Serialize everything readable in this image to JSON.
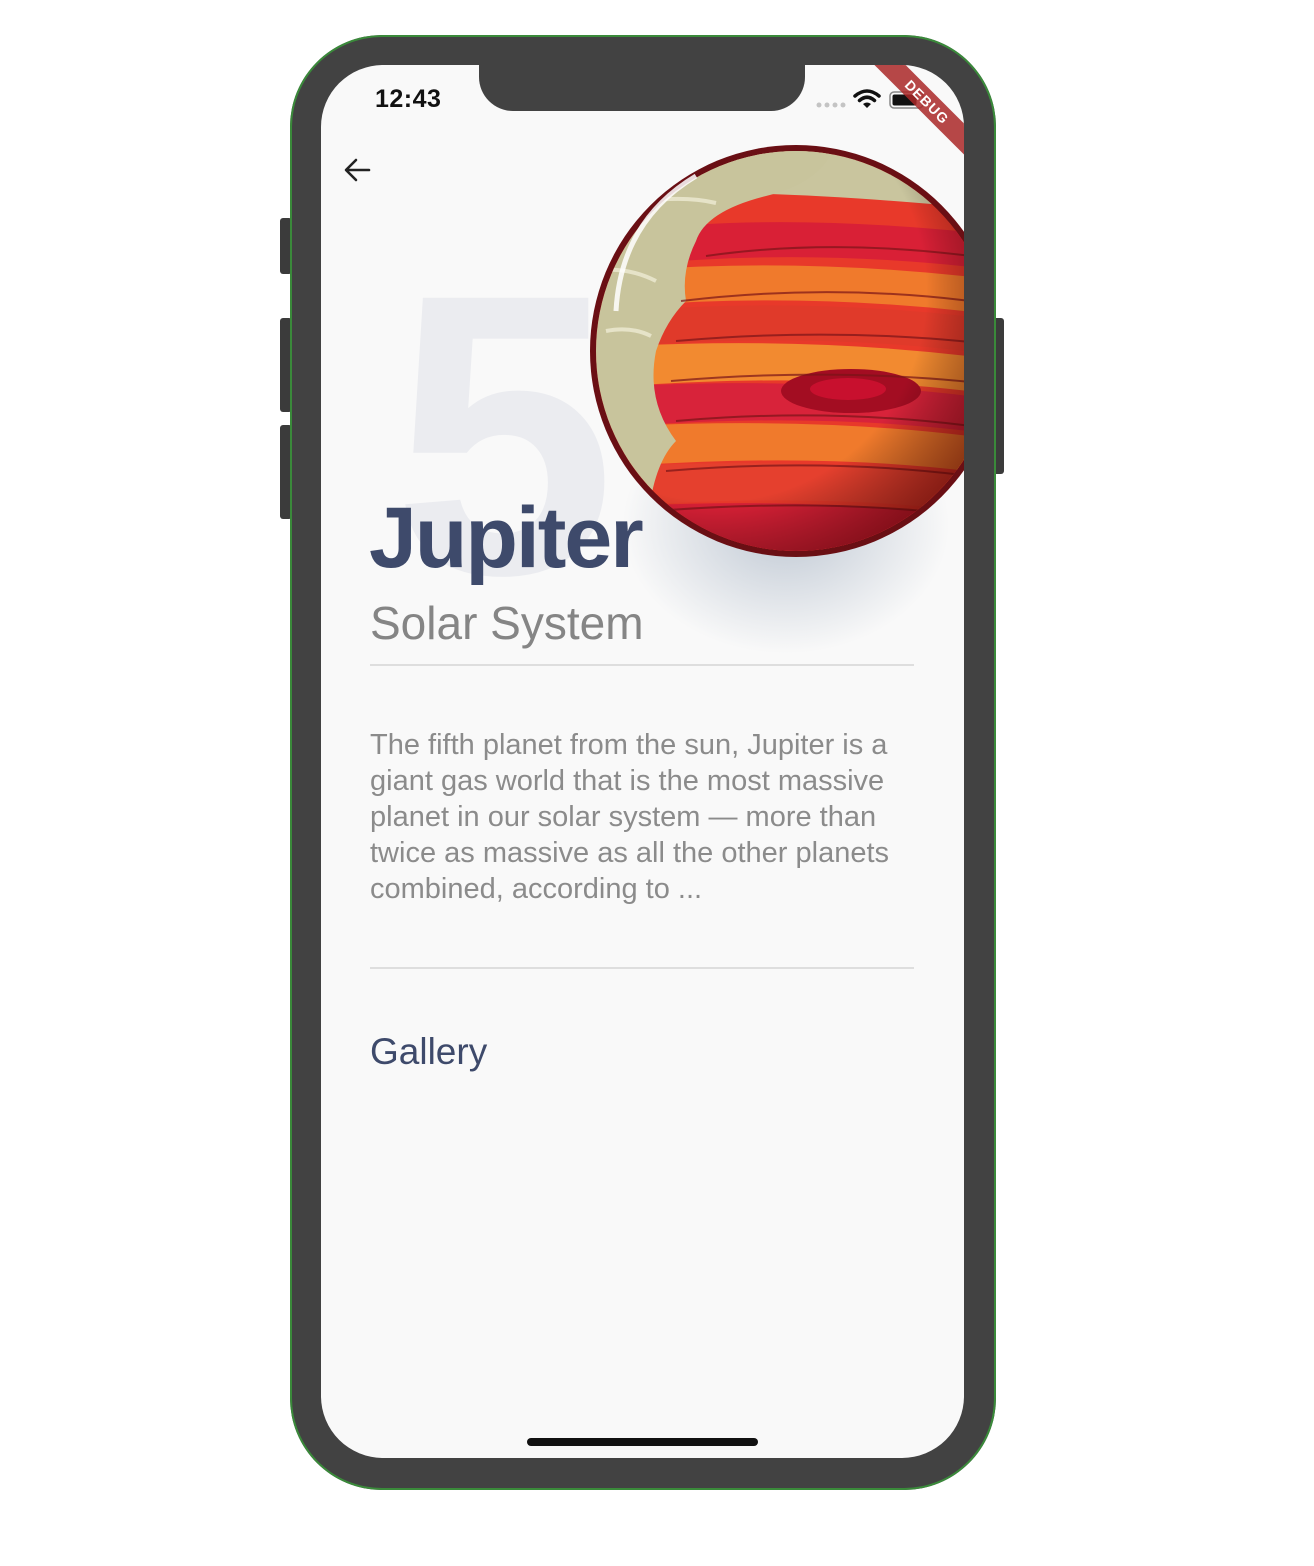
{
  "status_bar": {
    "time": "12:43",
    "icons": [
      "cellular-signal-icon",
      "wifi-icon",
      "battery-icon"
    ]
  },
  "debug_banner": "DEBUG",
  "nav": {
    "back_icon": "arrow-left-icon"
  },
  "planet": {
    "position_number": "5",
    "name": "Jupiter",
    "system": "Solar System",
    "description": "The fifth planet from the sun, Jupiter is a giant gas world that is the most massive planet in our solar system — more than twice as massive as all the other planets combined, according to ...",
    "image_icon": "jupiter-illustration"
  },
  "gallery": {
    "title": "Gallery"
  },
  "colors": {
    "title": "#3e4a6b",
    "subtitle": "#858585",
    "body_text": "#8b8b8b",
    "screen_bg": "#f9f9f9",
    "frame": "#424242"
  }
}
